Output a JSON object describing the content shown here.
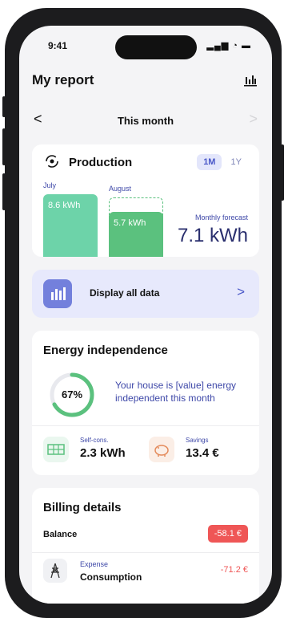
{
  "status_bar": {
    "time": "9:41",
    "icons": "▂▄▆ ◔ ▬"
  },
  "header": {
    "title": "My report",
    "chart_icon": "bar-chart-icon"
  },
  "period_nav": {
    "label": "This month",
    "prev": "<",
    "next": ">"
  },
  "production": {
    "title": "Production",
    "icon": "solar-cycle-icon",
    "segment": [
      "1M",
      "1Y"
    ],
    "bars": [
      {
        "month": "July",
        "value": "8.6 kWh"
      },
      {
        "month": "August",
        "value": "5.7 kWh"
      }
    ],
    "forecast_label": "Monthly forecast",
    "forecast_value": "7.1 kWh"
  },
  "display_all": {
    "label": "Display all data",
    "arrow": ">"
  },
  "energy_independence": {
    "title": "Energy independence",
    "percent_label": "67%",
    "percent": 0.67,
    "description": "Your house is [value] energy independent this month",
    "self_cons_label": "Self-cons.",
    "self_cons_value": "2.3 kWh",
    "savings_label": "Savings",
    "savings_value": "13.4 €"
  },
  "billing": {
    "title": "Billing details",
    "balance_label": "Balance",
    "balance_value": "-58.1 €",
    "expense_label": "Expense",
    "expense_name": "Consumption",
    "expense_value": "-71.2 €"
  },
  "colors": {
    "accent": "#4a58c8",
    "green": "#5bc17e",
    "teal": "#6dd3a9",
    "red": "#ef5656",
    "tile": "#e7e9fc"
  }
}
